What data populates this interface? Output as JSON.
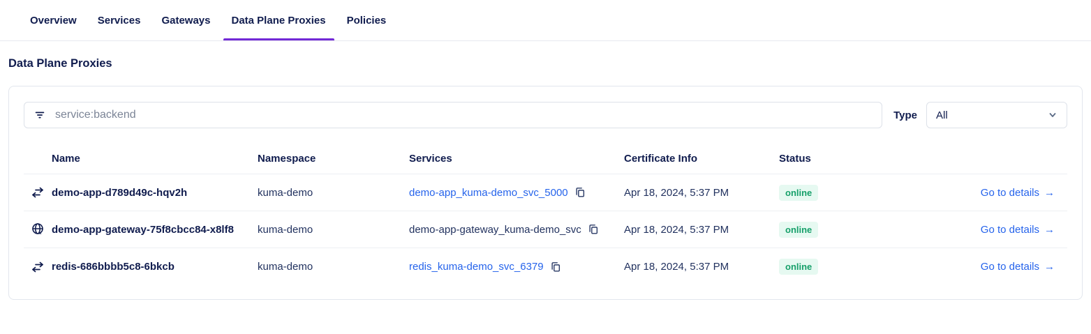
{
  "tabs": [
    {
      "label": "Overview"
    },
    {
      "label": "Services"
    },
    {
      "label": "Gateways"
    },
    {
      "label": "Data Plane Proxies"
    },
    {
      "label": "Policies"
    }
  ],
  "active_tab": "Data Plane Proxies",
  "page": {
    "title": "Data Plane Proxies"
  },
  "filters": {
    "search_placeholder": "service:backend",
    "filter_icon": "filter-lines-icon",
    "type_label": "Type",
    "type_value": "All",
    "type_chevron_icon": "chevron-down-icon"
  },
  "table": {
    "columns": {
      "name": "Name",
      "namespace": "Namespace",
      "services": "Services",
      "certificate": "Certificate Info",
      "status": "Status"
    },
    "rows": [
      {
        "icon": "proxy-icon",
        "name": "demo-app-d789d49c-hqv2h",
        "namespace": "kuma-demo",
        "service": "demo-app_kuma-demo_svc_5000",
        "service_is_link": true,
        "copy_icon": "copy-icon",
        "certificate": "Apr 18, 2024, 5:37 PM",
        "status": "online",
        "details_label": "Go to details",
        "details_arrow": "→"
      },
      {
        "icon": "gateway-globe-icon",
        "name": "demo-app-gateway-75f8cbcc84-x8lf8",
        "namespace": "kuma-demo",
        "service": "demo-app-gateway_kuma-demo_svc",
        "service_is_link": false,
        "copy_icon": "copy-icon",
        "certificate": "Apr 18, 2024, 5:37 PM",
        "status": "online",
        "details_label": "Go to details",
        "details_arrow": "→"
      },
      {
        "icon": "proxy-icon",
        "name": "redis-686bbbb5c8-6bkcb",
        "namespace": "kuma-demo",
        "service": "redis_kuma-demo_svc_6379",
        "service_is_link": true,
        "copy_icon": "copy-icon",
        "certificate": "Apr 18, 2024, 5:37 PM",
        "status": "online",
        "details_label": "Go to details",
        "details_arrow": "→"
      }
    ]
  },
  "colors": {
    "accent": "#7229d6",
    "link": "#2563eb",
    "online_bg": "#e6f9f1",
    "online_text": "#17a06a",
    "navy": "#101c4e"
  }
}
